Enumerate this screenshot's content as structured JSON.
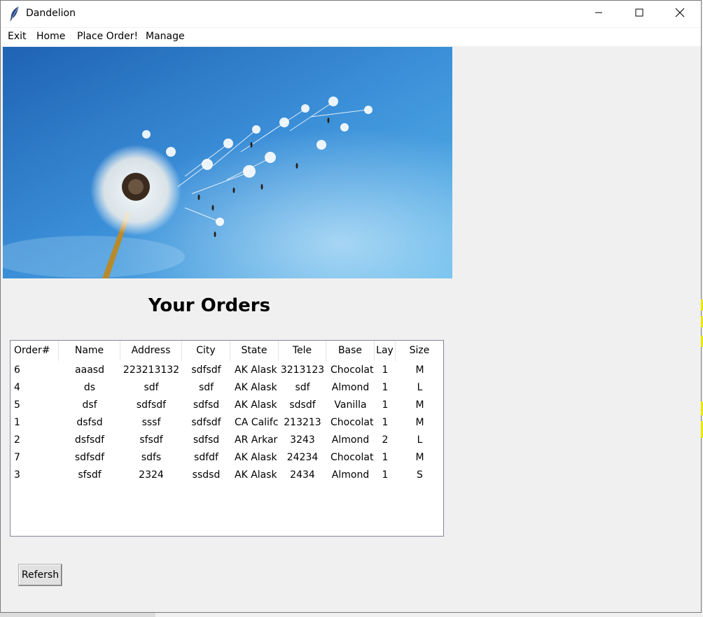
{
  "window": {
    "title": "Dandelion"
  },
  "menu": {
    "items": [
      "Exit",
      "Home",
      "Place Order!",
      "Manage"
    ]
  },
  "page": {
    "heading": "Your Orders",
    "refresh_label": "Refersh"
  },
  "table": {
    "columns": [
      "Order#",
      "Name",
      "Address",
      "City",
      "State",
      "Tele",
      "Base",
      "Lay",
      "Size"
    ],
    "rows": [
      [
        "6",
        "aaasd",
        "223213132",
        "sdfsdf",
        "AK Alask",
        "3213123",
        "Chocolat",
        "1",
        "M"
      ],
      [
        "4",
        "ds",
        "sdf",
        "sdf",
        "AK Alask",
        "sdf",
        "Almond",
        "1",
        "L"
      ],
      [
        "5",
        "dsf",
        "sdfsdf",
        "sdfsd",
        "AK Alask",
        "sdsdf",
        "Vanilla",
        "1",
        "M"
      ],
      [
        "1",
        "dsfsd",
        "sssf",
        "sdfsdf",
        "CA Califc",
        "213213",
        "Chocolat",
        "1",
        "M"
      ],
      [
        "2",
        "dsfsdf",
        "sfsdf",
        "sdfsd",
        "AR Arkar",
        "3243",
        "Almond",
        "2",
        "L"
      ],
      [
        "7",
        "sdfsdf",
        "sdfs",
        "sdfdf",
        "AK Alask",
        "24234",
        "Chocolat",
        "1",
        "M"
      ],
      [
        "3",
        "sfsdf",
        "2324",
        "ssdsd",
        "AK Alask",
        "2434",
        "Almond",
        "1",
        "S"
      ]
    ]
  },
  "colors": {
    "sky_top": "#1f63b4",
    "sky_bottom": "#4aa8e6",
    "accent_edge": "#e8e800"
  },
  "icons": {
    "app": "feather-icon",
    "minimize": "minimize-icon",
    "maximize": "maximize-icon",
    "close": "close-icon"
  }
}
